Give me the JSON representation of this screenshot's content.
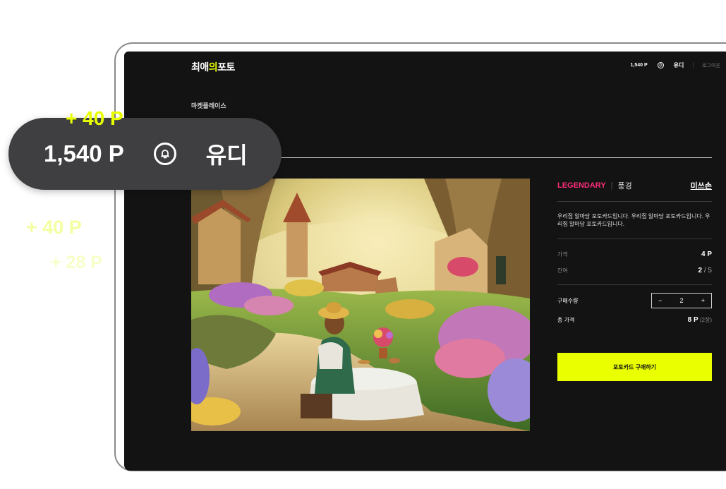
{
  "app": {
    "logo_prefix": "최애",
    "logo_highlight": "의",
    "logo_suffix": "포토"
  },
  "header": {
    "points": "1,540 P",
    "bell_icon": "bell-icon",
    "user": "유디",
    "separator": "|",
    "logout": "로그아웃"
  },
  "breadcrumb": "마켓플레이스",
  "card": {
    "rarity": "LEGENDARY",
    "separator": "|",
    "category": "풍경",
    "seller": "미쓰손",
    "description": "우리집 알마당 포토카드입니다. 우리집 알마당 포토카드입니다. 우리집 알마당 포토카드입니다.",
    "price_label": "가격",
    "price_value": "4 P",
    "remaining_label": "잔여",
    "remaining_value": "2",
    "remaining_total": " / 5",
    "qty_label": "구매수량",
    "qty_minus": "−",
    "qty_value": "2",
    "qty_plus": "+",
    "total_label": "총 가격",
    "total_value": "8 P",
    "total_count": " (2장)",
    "buy_button": "포토카드 구매하기"
  },
  "overlay": {
    "points": "1,540 P",
    "bell_icon": "bell-icon",
    "user": "유디",
    "floating": [
      "+ 40 P",
      "+ 40 P",
      "+ 28 P"
    ]
  },
  "colors": {
    "accent": "#EAFF00",
    "rarity": "#FF2D7A",
    "background": "#131313",
    "pill": "#3F3F41"
  }
}
